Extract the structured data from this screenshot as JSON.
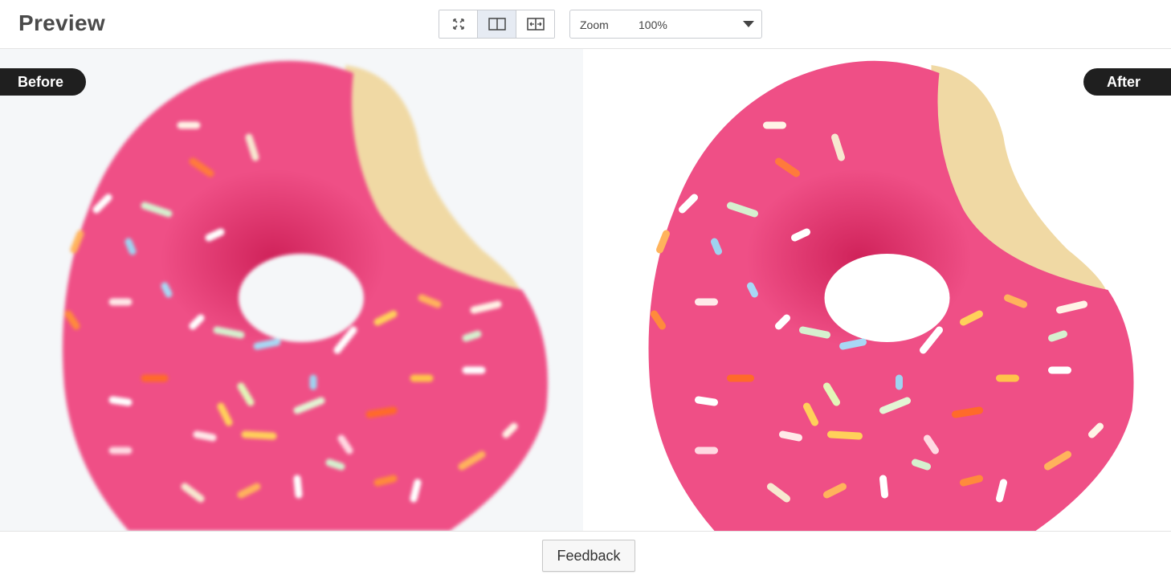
{
  "header": {
    "title": "Preview",
    "view_modes": [
      {
        "icon": "fit-screen-icon",
        "active": false
      },
      {
        "icon": "split-view-icon",
        "active": true
      },
      {
        "icon": "slider-compare-icon",
        "active": false
      }
    ],
    "zoom": {
      "label": "Zoom",
      "value": "100%"
    }
  },
  "panes": {
    "before_label": "Before",
    "after_label": "After"
  },
  "footer": {
    "feedback_label": "Feedback"
  },
  "colors": {
    "icing": "#ef4f86",
    "icing_dark": "#d62b63",
    "cake": "#f0d9a4",
    "tag_bg": "#1f1f1f",
    "active_btn": "#e6ebf3"
  }
}
